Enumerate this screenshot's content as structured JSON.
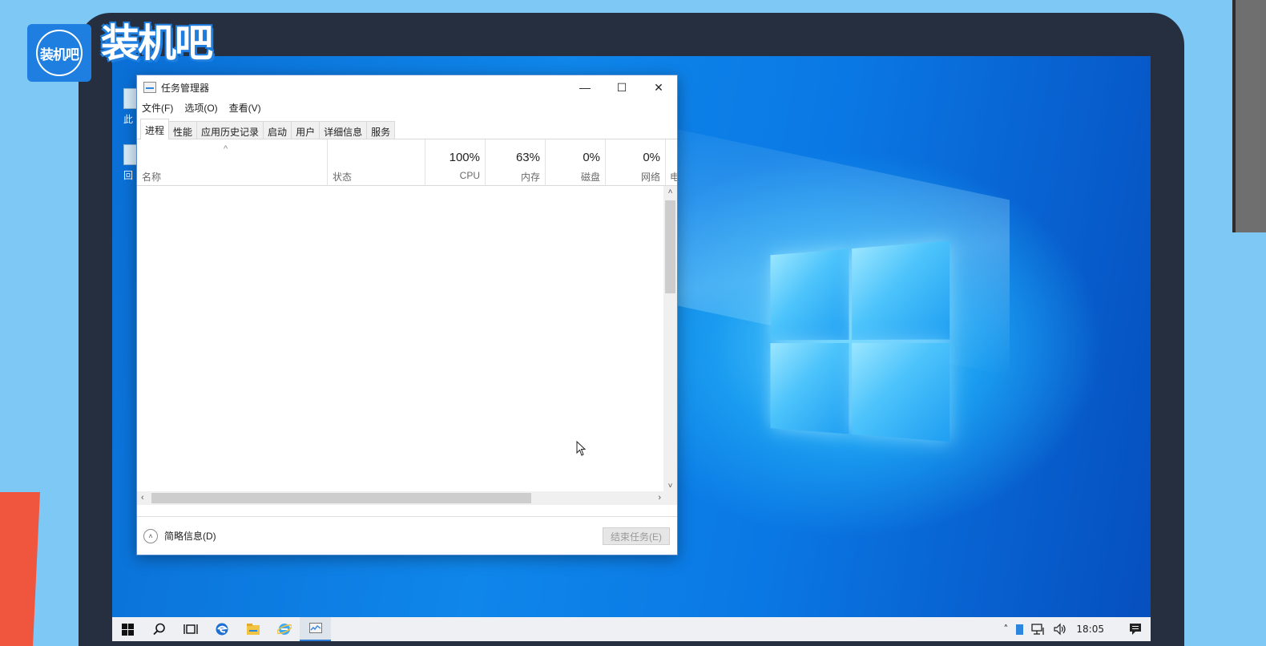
{
  "brand": {
    "logo_badge": "装机吧",
    "logo_text": "装机吧"
  },
  "desktop": {
    "icon_labels": [
      "此",
      "回"
    ]
  },
  "window": {
    "title": "任务管理器",
    "controls": {
      "minimize": "—",
      "maximize": "☐",
      "close": "✕"
    },
    "menu": [
      "文件(F)",
      "选项(O)",
      "查看(V)"
    ],
    "tabs": [
      {
        "label": "进程",
        "active": true
      },
      {
        "label": "性能",
        "active": false
      },
      {
        "label": "应用历史记录",
        "active": false
      },
      {
        "label": "启动",
        "active": false
      },
      {
        "label": "用户",
        "active": false
      },
      {
        "label": "详细信息",
        "active": false
      },
      {
        "label": "服务",
        "active": false
      }
    ],
    "columns": {
      "name": "名称",
      "status": "状态",
      "cpu": {
        "pct": "100%",
        "label": "CPU"
      },
      "memory": {
        "pct": "63%",
        "label": "内存"
      },
      "disk": {
        "pct": "0%",
        "label": "磁盘"
      },
      "network": {
        "pct": "0%",
        "label": "网络"
      },
      "power": "电"
    },
    "sort_indicator": "^",
    "footer": {
      "fewer_details": "简略信息(D)",
      "end_task": "结束任务(E)"
    }
  },
  "taskbar": {
    "time": "18:05"
  },
  "colors": {
    "accent": "#2c86e0",
    "window_border": "#5a8ccf",
    "brand_blue": "#1f7fe0"
  }
}
